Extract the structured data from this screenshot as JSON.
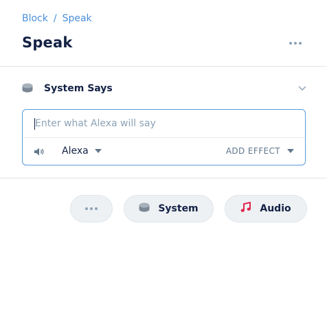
{
  "breadcrumb": {
    "parent": "Block",
    "separator": "/",
    "current": "Speak"
  },
  "header": {
    "title": "Speak"
  },
  "section": {
    "label": "System Says",
    "icon": "speaker-puck-icon"
  },
  "editor": {
    "placeholder": "Enter what Alexa will say",
    "value": "",
    "voice": "Alexa",
    "effect_label": "ADD EFFECT"
  },
  "steps": [
    {
      "label": "System",
      "icon": "speaker-puck-icon"
    },
    {
      "label": "Audio",
      "icon": "music-note-icon"
    }
  ],
  "colors": {
    "accent": "#4a8fd9",
    "border_focus": "#5b9ad7",
    "audio_icon": "#e0254d",
    "muted": "#8da2b5"
  }
}
